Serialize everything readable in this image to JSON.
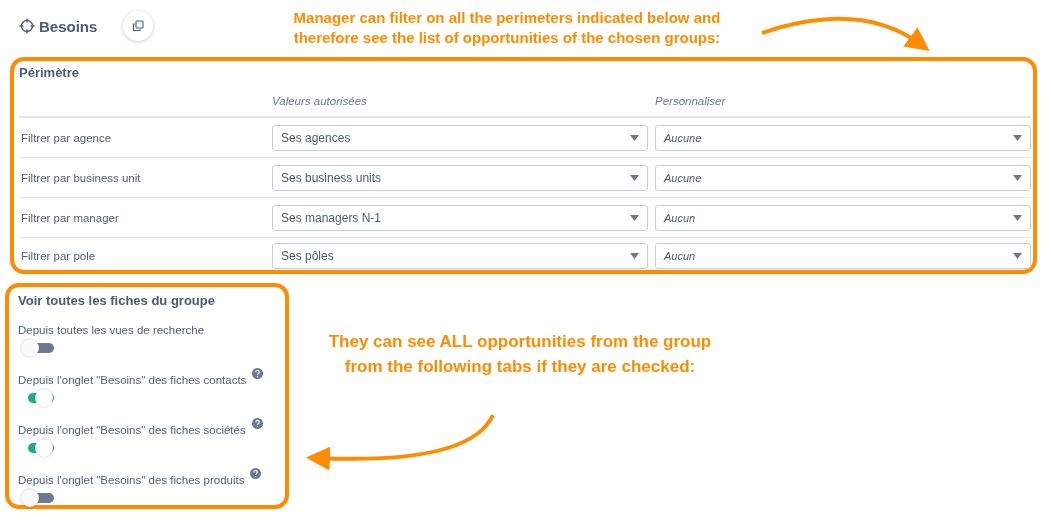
{
  "header": {
    "title": "Besoins"
  },
  "annotations": [
    {
      "text": "Manager can filter on all the perimeters indicated below and therefore see the list of opportunities of the chosen groups:"
    },
    {
      "text": "They can see ALL opportunities from the group from the following tabs if they are checked:"
    }
  ],
  "perimeter": {
    "title": "Périmètre",
    "columns": [
      "Valeurs autorisées",
      "Personnaliser"
    ],
    "rows": [
      {
        "label": "Filtrer par agence",
        "value": "Ses agences",
        "custom": "Aucune"
      },
      {
        "label": "Filtrer par business unit",
        "value": "Ses business units",
        "custom": "Aucune"
      },
      {
        "label": "Filtrer par manager",
        "value": "Ses managers N-1",
        "custom": "Aucun"
      },
      {
        "label": "Filtrer par pole",
        "value": "Ses pôles",
        "custom": "Aucun"
      }
    ]
  },
  "group_view": {
    "title": "Voir toutes les fiches du groupe",
    "items": [
      {
        "label": "Depuis toutes les vues de recherche",
        "on": false,
        "help": false
      },
      {
        "label": "Depuis l'onglet \"Besoins\" des fiches contacts",
        "on": true,
        "help": true
      },
      {
        "label": "Depuis l'onglet \"Besoins\" des fiches sociétés",
        "on": true,
        "help": true
      },
      {
        "label": "Depuis l'onglet \"Besoins\" des fiches produits",
        "on": false,
        "help": true
      }
    ]
  }
}
